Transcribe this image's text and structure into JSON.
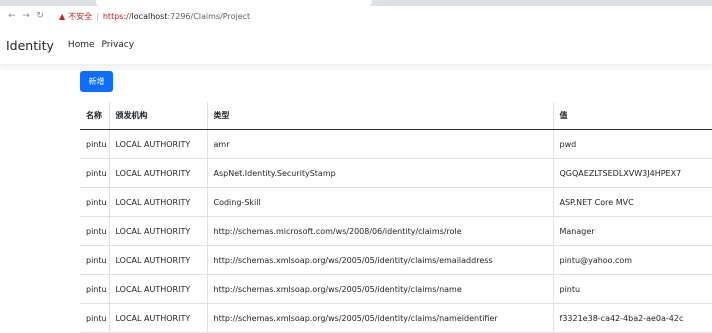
{
  "browser": {
    "security_label": "不安全",
    "url_scheme": "https://",
    "url_host": "localhost",
    "url_path": ":7296/Claims/Project"
  },
  "navbar": {
    "brand": "Identity",
    "links": [
      "Home",
      "Privacy"
    ]
  },
  "actions": {
    "add_label": "新增"
  },
  "table": {
    "headers": [
      "名称",
      "颁发机构",
      "类型",
      "值"
    ],
    "rows": [
      [
        "pintu",
        "LOCAL AUTHORITY",
        "amr",
        "pwd"
      ],
      [
        "pintu",
        "LOCAL AUTHORITY",
        "AspNet.Identity.SecurityStamp",
        "QGQAEZLTSEDLXVW3J4HPEX7"
      ],
      [
        "pintu",
        "LOCAL AUTHORITY",
        "Coding-Skill",
        "ASP.NET Core MVC"
      ],
      [
        "pintu",
        "LOCAL AUTHORITY",
        "http://schemas.microsoft.com/ws/2008/06/identity/claims/role",
        "Manager"
      ],
      [
        "pintu",
        "LOCAL AUTHORITY",
        "http://schemas.xmlsoap.org/ws/2005/05/identity/claims/emailaddress",
        "pintu@yahoo.com"
      ],
      [
        "pintu",
        "LOCAL AUTHORITY",
        "http://schemas.xmlsoap.org/ws/2005/05/identity/claims/name",
        "pintu"
      ],
      [
        "pintu",
        "LOCAL AUTHORITY",
        "http://schemas.xmlsoap.org/ws/2005/05/identity/claims/nameidentifier",
        "f3321e38-ca42-4ba2-ae0a-42c"
      ]
    ]
  }
}
